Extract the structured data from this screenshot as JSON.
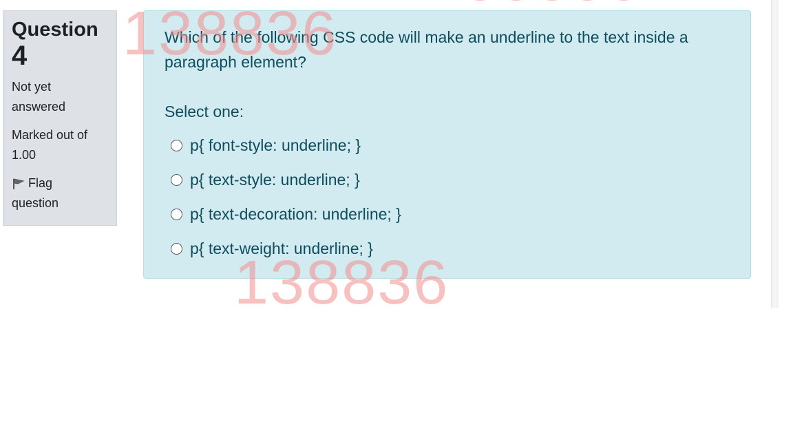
{
  "sidebar": {
    "question_label": "Question",
    "question_number": "4",
    "status_line1": "Not yet",
    "status_line2": "answered",
    "marks_line1": "Marked out of",
    "marks_line2": "1.00",
    "flag_line1": "Flag",
    "flag_line2": "question",
    "flag_icon": "flag-icon"
  },
  "question": {
    "text": "Which of the following CSS code will make an underline to the text inside a paragraph element?",
    "prompt": "Select one:",
    "answers": [
      {
        "label": "p{ font-style: underline; }",
        "selected": false
      },
      {
        "label": "p{ text-style: underline; }",
        "selected": false
      },
      {
        "label": "p{ text-decoration: underline; }",
        "selected": false
      },
      {
        "label": "p{ text-weight: underline; }",
        "selected": false
      }
    ]
  },
  "watermark": {
    "text": "138836",
    "color": "#f48f8f"
  },
  "colors": {
    "info_bg": "#dee2e6",
    "content_bg": "#d1ebf0",
    "content_text": "#0f4c5c"
  }
}
